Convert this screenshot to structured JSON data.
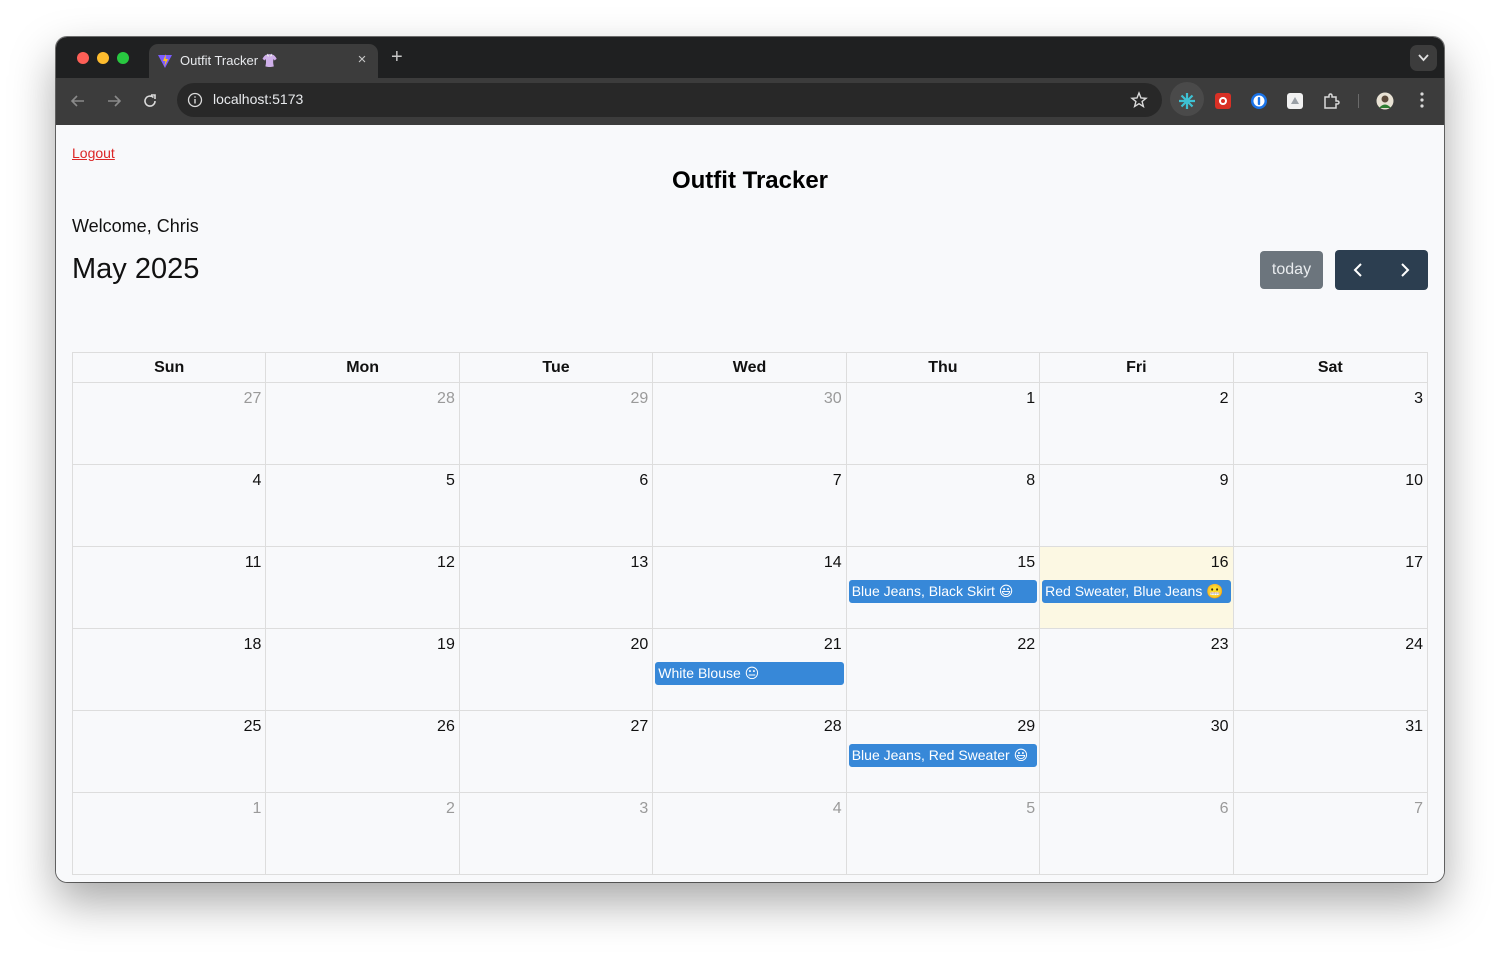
{
  "browser": {
    "tab_title": "Outfit Tracker 👚",
    "tab_close": "×",
    "new_tab": "+",
    "url": "localhost:5173"
  },
  "page": {
    "logout_label": "Logout",
    "app_title": "Outfit Tracker",
    "welcome": "Welcome, Chris",
    "month_title": "May 2025",
    "today_label": "today"
  },
  "calendar": {
    "weekdays": [
      "Sun",
      "Mon",
      "Tue",
      "Wed",
      "Thu",
      "Fri",
      "Sat"
    ],
    "weeks": [
      [
        "27",
        "28",
        "29",
        "30",
        "1",
        "2",
        "3"
      ],
      [
        "4",
        "5",
        "6",
        "7",
        "8",
        "9",
        "10"
      ],
      [
        "11",
        "12",
        "13",
        "14",
        "15",
        "16",
        "17"
      ],
      [
        "18",
        "19",
        "20",
        "21",
        "22",
        "23",
        "24"
      ],
      [
        "25",
        "26",
        "27",
        "28",
        "29",
        "30",
        "31"
      ],
      [
        "1",
        "2",
        "3",
        "4",
        "5",
        "6",
        "7"
      ]
    ],
    "events": {
      "may15": "Blue Jeans, Black Skirt 😃",
      "may16": "Red Sweater, Blue Jeans 😬",
      "may21": "White Blouse 😐",
      "may29": "Blue Jeans, Red Sweater 😃"
    }
  },
  "colors": {
    "event": "#3788d8",
    "today_highlight": "#fcf8e3",
    "logout": "#dc2626",
    "nav_buttons": "#2c3e50",
    "today_button": "#6c757d"
  }
}
